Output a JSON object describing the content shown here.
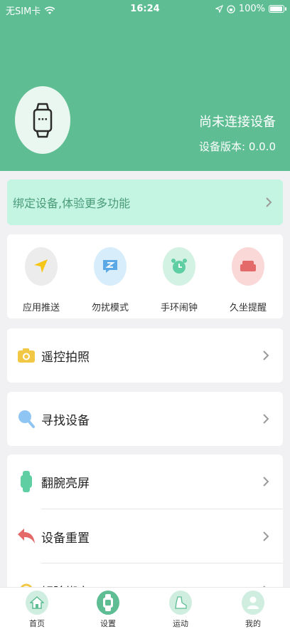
{
  "status_bar": {
    "carrier": "无SIM卡",
    "time": "16:24",
    "battery": "100%"
  },
  "header": {
    "connection_status": "尚未连接设备",
    "version": "设备版本: 0.0.0"
  },
  "bind_banner": {
    "text": "绑定设备,体验更多功能"
  },
  "features": [
    {
      "label": "应用推送",
      "icon": "send-arrow-icon"
    },
    {
      "label": "勿扰模式",
      "icon": "do-not-disturb-icon"
    },
    {
      "label": "手环闹钟",
      "icon": "alarm-clock-icon"
    },
    {
      "label": "久坐提醒",
      "icon": "sofa-icon"
    }
  ],
  "menu": {
    "camera": "遥控拍照",
    "find_device": "寻找设备",
    "wrist_wake": "翻腕亮屏",
    "reset": "设备重置",
    "unbind": "解除绑定"
  },
  "tabs": [
    {
      "label": "首页",
      "icon": "home-icon"
    },
    {
      "label": "设置",
      "icon": "watch-icon"
    },
    {
      "label": "运动",
      "icon": "shoe-icon"
    },
    {
      "label": "我的",
      "icon": "user-icon"
    }
  ],
  "colors": {
    "brand_green": "#5ebd93",
    "banner_bg": "#c3f5e2",
    "banner_text": "#4a9a78"
  }
}
